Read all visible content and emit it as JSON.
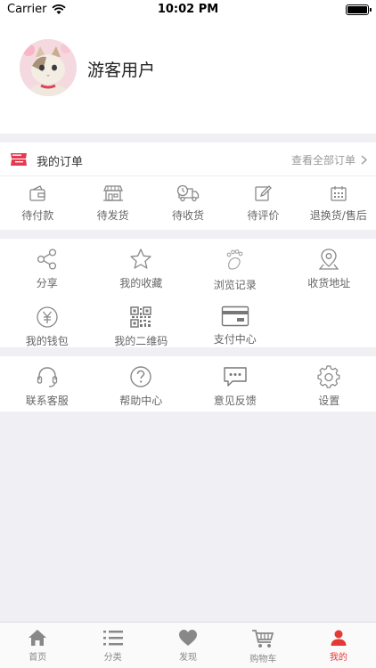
{
  "status": {
    "carrier": "Carrier",
    "time": "10:02 PM"
  },
  "profile": {
    "username": "游客用户"
  },
  "orders": {
    "title": "我的订单",
    "view_all": "查看全部订单",
    "items": [
      {
        "label": "待付款",
        "icon": "wallet-icon"
      },
      {
        "label": "待发货",
        "icon": "shop-icon"
      },
      {
        "label": "待收货",
        "icon": "delivery-truck-icon"
      },
      {
        "label": "待评价",
        "icon": "edit-icon"
      },
      {
        "label": "退换货/售后",
        "icon": "calendar-icon"
      }
    ]
  },
  "services": {
    "row1": [
      {
        "label": "分享",
        "icon": "share-icon"
      },
      {
        "label": "我的收藏",
        "icon": "star-icon"
      },
      {
        "label": "浏览记录",
        "icon": "footprint-icon"
      },
      {
        "label": "收货地址",
        "icon": "location-icon"
      }
    ],
    "row2": [
      {
        "label": "我的钱包",
        "icon": "yuan-icon"
      },
      {
        "label": "我的二维码",
        "icon": "qrcode-icon"
      },
      {
        "label": "支付中心",
        "icon": "card-icon"
      }
    ]
  },
  "support": {
    "items": [
      {
        "label": "联系客服",
        "icon": "headset-icon"
      },
      {
        "label": "帮助中心",
        "icon": "help-icon"
      },
      {
        "label": "意见反馈",
        "icon": "feedback-icon"
      },
      {
        "label": "设置",
        "icon": "settings-icon"
      }
    ]
  },
  "tabbar": {
    "items": [
      {
        "label": "首页",
        "icon": "home-icon"
      },
      {
        "label": "分类",
        "icon": "list-icon"
      },
      {
        "label": "发现",
        "icon": "heart-icon"
      },
      {
        "label": "购物车",
        "icon": "cart-icon"
      },
      {
        "label": "我的",
        "icon": "person-icon"
      }
    ],
    "active_color": "#e53935"
  }
}
